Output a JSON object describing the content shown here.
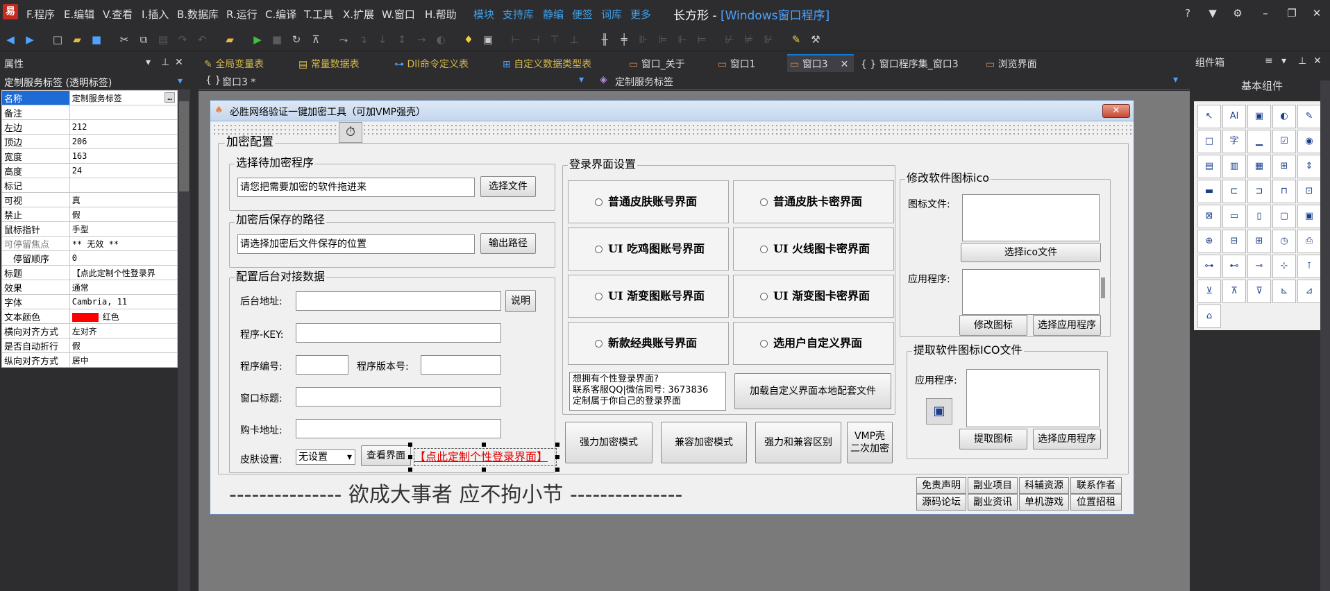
{
  "menu": {
    "items": [
      "F.程序",
      "E.编辑",
      "V.查看",
      "I.插入",
      "B.数据库",
      "R.运行",
      "C.编译",
      "T.工具",
      "X.扩展",
      "W.窗口",
      "H.帮助"
    ],
    "links": [
      "模块",
      "支持库",
      "静编",
      "便签",
      "词库",
      "更多"
    ],
    "title_prefix": "长方形 - ",
    "title_accent": "[Windows窗口程序]"
  },
  "props": {
    "header": "属性",
    "selected": "定制服务标签  (透明标签)",
    "rows": [
      {
        "k": "名称",
        "v": "定制服务标签"
      },
      {
        "k": "备注",
        "v": ""
      },
      {
        "k": "左边",
        "v": "212"
      },
      {
        "k": "顶边",
        "v": "206"
      },
      {
        "k": "宽度",
        "v": "163"
      },
      {
        "k": "高度",
        "v": "24"
      },
      {
        "k": "标记",
        "v": ""
      },
      {
        "k": "可视",
        "v": "真"
      },
      {
        "k": "禁止",
        "v": "假"
      },
      {
        "k": "鼠标指针",
        "v": "手型"
      },
      {
        "k": "可停留焦点",
        "v": "** 无效 **"
      },
      {
        "k": "停留顺序",
        "v": "0"
      },
      {
        "k": "标题",
        "v": "【点此定制个性登录界"
      },
      {
        "k": "效果",
        "v": "通常"
      },
      {
        "k": "字体",
        "v": "Cambria, 11"
      },
      {
        "k": "文本颜色",
        "v": "红色"
      },
      {
        "k": "横向对齐方式",
        "v": "左对齐"
      },
      {
        "k": "是否自动折行",
        "v": "假"
      },
      {
        "k": "纵向对齐方式",
        "v": "居中"
      }
    ],
    "text_color": "#ff0000"
  },
  "tabs": [
    {
      "label": "全局变量表",
      "color": "#d4b84a"
    },
    {
      "label": "常量数据表",
      "color": "#d4b84a"
    },
    {
      "label": "Dll命令定义表",
      "color": "#d4b84a"
    },
    {
      "label": "自定义数据类型表",
      "color": "#d4b84a"
    },
    {
      "label": "窗口_关于",
      "color": "#dddddd"
    },
    {
      "label": "窗口1",
      "color": "#dddddd"
    },
    {
      "label": "窗口3",
      "color": "#dddddd"
    },
    {
      "label": "窗口程序集_窗口3",
      "color": "#dddddd"
    },
    {
      "label": "浏览界面",
      "color": "#dddddd"
    }
  ],
  "subbar": {
    "left": "窗口3 *",
    "right": "定制服务标签"
  },
  "form": {
    "title": "必胜网络验证一键加密工具（可加VMP强壳）",
    "close": "✕",
    "group_main": "加密配置",
    "g1": {
      "title": "选择待加密程序",
      "input": "请您把需要加密的软件拖进来",
      "button": "选择文件"
    },
    "g2": {
      "title": "加密后保存的路径",
      "input": "请选择加密后文件保存的位置",
      "button": "输出路径"
    },
    "g3": {
      "title": "配置后台对接数据",
      "backend": "后台地址:",
      "explain": "说明",
      "key": "程序-KEY:",
      "prog_no": "程序编号:",
      "prog_ver": "程序版本号:",
      "win_title": "窗口标题:",
      "buy": "购卡地址:",
      "skin": "皮肤设置:",
      "skin_val": "无设置",
      "view": "查看界面",
      "custom_label": "【点此定制个性登录界面】"
    },
    "login": {
      "title": "登录界面设置",
      "options": [
        "普通皮肤账号界面",
        "普通皮肤卡密界面",
        "UI 吃鸡图账号界面",
        "UI 火线图卡密界面",
        "UI 渐变图账号界面",
        "UI 渐变图卡密界面",
        "新款经典账号界面",
        "选用户自定义界面"
      ],
      "contact": [
        "想拥有个性登录界面?",
        "联系客服QQ|微信同号: 3673836",
        "定制属于你自己的登录界面"
      ],
      "load_btn": "加载自定义界面本地配套文件"
    },
    "modes": [
      "强力加密模式",
      "兼容加密模式",
      "强力和兼容区别"
    ],
    "vmp": [
      "VMP壳",
      "二次加密"
    ],
    "icon": {
      "title": "修改软件图标ico",
      "icon_file": "图标文件:",
      "select_ico": "选择ico文件",
      "app": "应用程序:",
      "modify": "修改图标",
      "select_app": "选择应用程序"
    },
    "extract": {
      "title": "提取软件图标ICO文件",
      "app": "应用程序:",
      "extract": "提取图标",
      "select_app": "选择应用程序"
    },
    "slogan": "---------------  欲成大事者  应不拘小节  ---------------",
    "links": [
      "免责声明",
      "副业项目",
      "科辅资源",
      "联系作者",
      "源码论坛",
      "副业资讯",
      "单机游戏",
      "位置招租"
    ]
  },
  "components": {
    "header": "组件箱",
    "group": "基本组件",
    "items": [
      "↖",
      "Al",
      "▣",
      "◐",
      "✎",
      "□",
      "字",
      "▁",
      "☑",
      "◉",
      "▤",
      "▥",
      "▦",
      "⊞",
      "⇕",
      "▬",
      "⊏",
      "⊐",
      "⊓",
      "⊡",
      "⊠",
      "▭",
      "▯",
      "▢",
      "▣",
      "⊕",
      "⊟",
      "⊞",
      "◷",
      "⎙",
      "⊶",
      "⊷",
      "⊸",
      "⊹",
      "⊺",
      "⊻",
      "⊼",
      "⊽",
      "⊾",
      "⊿",
      "⌂"
    ]
  }
}
